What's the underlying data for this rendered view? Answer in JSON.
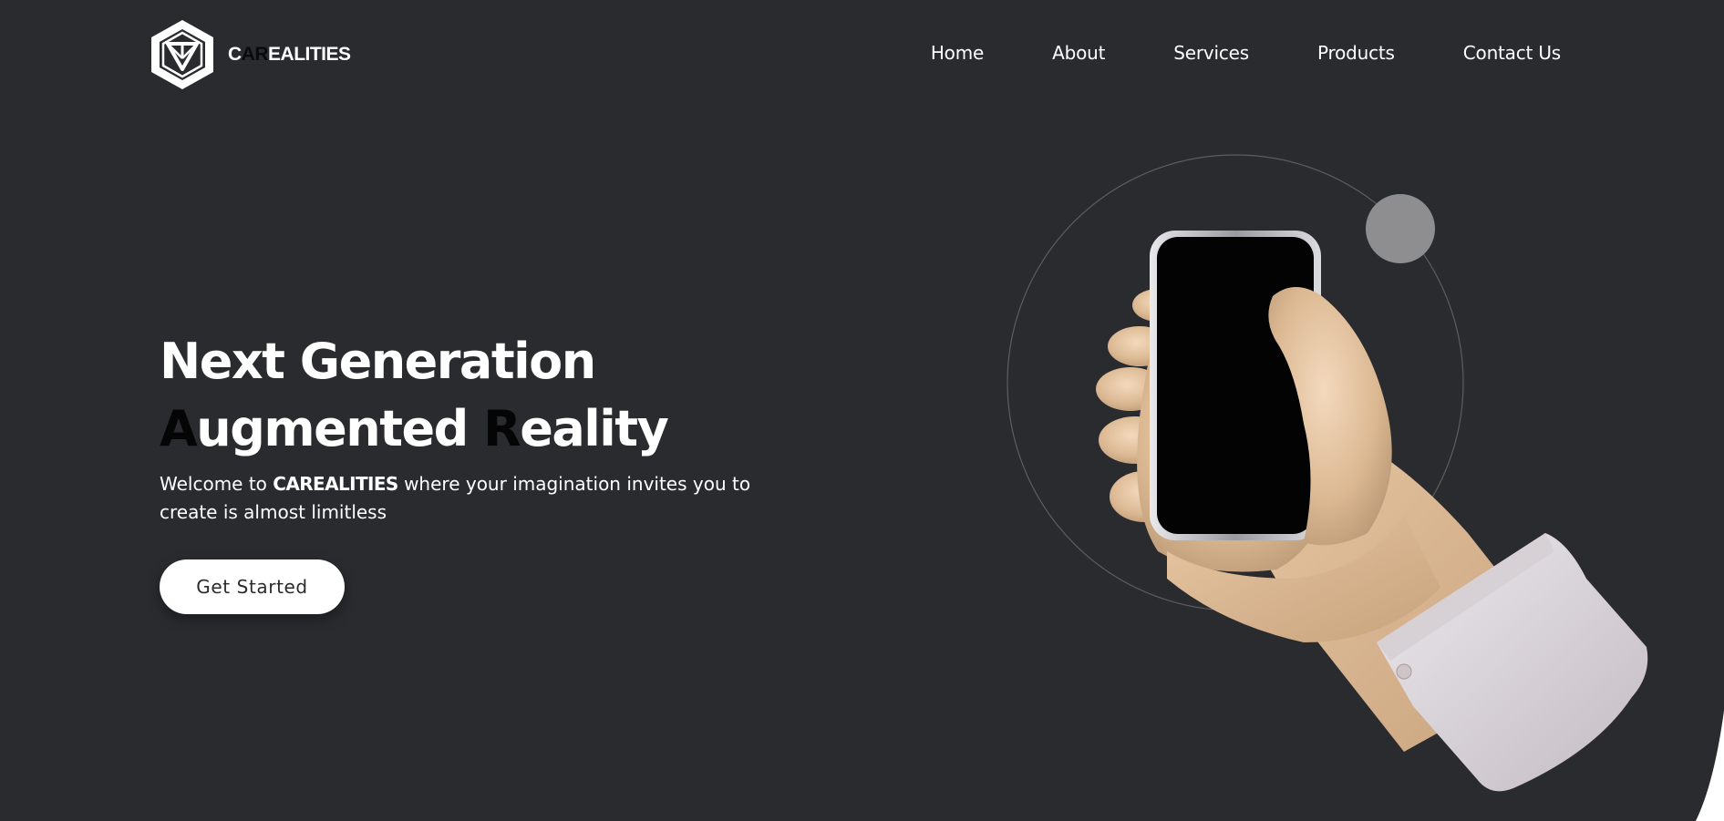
{
  "brand": {
    "name": "CAREALITIES",
    "logo_parts": [
      "C",
      "AR",
      "EALITIES"
    ]
  },
  "nav": {
    "items": [
      "Home",
      "About",
      "Services",
      "Products",
      "Contact Us"
    ]
  },
  "hero": {
    "headline_line1": "Next Generation",
    "headline_line2_parts": [
      "A",
      "ugmented ",
      "R",
      "eality"
    ],
    "subtitle_prefix": "Welcome to ",
    "subtitle_brand": "CAREALITIES",
    "subtitle_suffix": " where your imagination invites you to create is almost limitless",
    "cta_label": "Get Started"
  },
  "colors": {
    "background": "#2a2b2f",
    "page_corner": "#ffffff",
    "text": "#ffffff",
    "accent_dark": "#050505",
    "cta_bg": "#ffffff"
  },
  "icons": {
    "logo": "hexagon-triangle-logo-icon",
    "illustration": "hand-holding-phone"
  }
}
